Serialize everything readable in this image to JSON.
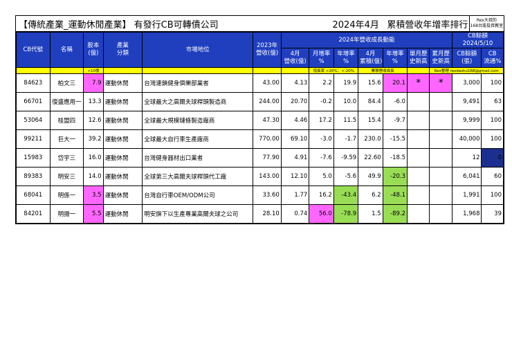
{
  "title": {
    "main": "【傳統產業_運動休閒產業】 有發行CB可轉債公司",
    "month": "2024年4月",
    "rank": "累積營收年增率排行"
  },
  "badge": {
    "line1": "Rex大叔的",
    "line2": "168台股投資教室"
  },
  "headers": {
    "cb_code": "CB代號",
    "name": "名稱",
    "capital": "股本\n(億)",
    "category": "產業\n分類",
    "position": "市場地位",
    "rev2023": "2023年\n營收(億)",
    "group_growth": "2024年營收成長動能",
    "apr_rev": "4月\n營收(億)",
    "mom": "月增率\n%",
    "yoy": "年增率\n%",
    "apr_cum": "4月\n累積(億)",
    "cum_yoy": "年增率\n%",
    "single_high": "單月歷\n史新高",
    "cum_high": "累月歷\n史新高",
    "group_cb": "CB餘額\n2024/5/10",
    "cb_bal": "CB餘額\n(張)",
    "cb_ratio": "CB\n流通%"
  },
  "notes": {
    "capital": "<10億",
    "mom": "增長率 >20%；<-20%",
    "cum": "累積營收成長",
    "rex": "Rex整理 rexdashu168@gmail.com"
  },
  "rows": [
    {
      "code": "84623",
      "name": "柏文三",
      "capital": "7.9",
      "category": "運動休閒",
      "position": "台灣連鎖健身俱樂部業者",
      "rev2023": "43.00",
      "apr_rev": "4.13",
      "mom": "2.2",
      "yoy": "19.9",
      "apr_cum": "15.6",
      "cum_yoy": "20.1",
      "single_high": "*",
      "cum_high": "*",
      "cb_bal": "3,000",
      "cb_ratio": "100"
    },
    {
      "code": "66701",
      "name": "復盛應用一",
      "capital": "13.3",
      "category": "運動休閒",
      "position": "全球最大之高爾夫球桿頭製造商",
      "rev2023": "244.00",
      "apr_rev": "20.70",
      "mom": "-0.2",
      "yoy": "10.0",
      "apr_cum": "84.4",
      "cum_yoy": "-6.0",
      "single_high": "",
      "cum_high": "",
      "cb_bal": "9,491",
      "cb_ratio": "63"
    },
    {
      "code": "53064",
      "name": "桂盟四",
      "capital": "12.6",
      "category": "運動休閒",
      "position": "全球最大規模鏈條製造廠商",
      "rev2023": "47.30",
      "apr_rev": "4.46",
      "mom": "17.2",
      "yoy": "11.5",
      "apr_cum": "15.4",
      "cum_yoy": "-9.7",
      "single_high": "",
      "cum_high": "",
      "cb_bal": "9,999",
      "cb_ratio": "100"
    },
    {
      "code": "99211",
      "name": "巨大一",
      "capital": "39.2",
      "category": "運動休閒",
      "position": "全球最大自行車生產廠商",
      "rev2023": "770.00",
      "apr_rev": "69.10",
      "mom": "-3.0",
      "yoy": "-1.7",
      "apr_cum": "230.0",
      "cum_yoy": "-15.5",
      "single_high": "",
      "cum_high": "",
      "cb_bal": "40,000",
      "cb_ratio": "100"
    },
    {
      "code": "15983",
      "name": "岱宇三",
      "capital": "16.0",
      "category": "運動休閒",
      "position": "台灣健身器材出口業者",
      "rev2023": "77.90",
      "apr_rev": "4.91",
      "mom": "-7.6",
      "yoy": "-9.59",
      "apr_cum": "22.60",
      "cum_yoy": "-18.5",
      "single_high": "",
      "cum_high": "",
      "cb_bal": "12",
      "cb_ratio": "0"
    },
    {
      "code": "89383",
      "name": "明安三",
      "capital": "14.0",
      "category": "運動休閒",
      "position": "全球第三大高爾夫球桿頭代工廠",
      "rev2023": "143.00",
      "apr_rev": "12.10",
      "mom": "5.0",
      "yoy": "-5.6",
      "apr_cum": "49.9",
      "cum_yoy": "-20.3",
      "single_high": "",
      "cum_high": "",
      "cb_bal": "6,041",
      "cb_ratio": "60"
    },
    {
      "code": "68041",
      "name": "明係一",
      "capital": "3.5",
      "category": "運動休閒",
      "position": "台灣自行車OEM/ODM公司",
      "rev2023": "33.60",
      "apr_rev": "1.77",
      "mom": "16.2",
      "yoy": "-43.4",
      "apr_cum": "6.2",
      "cum_yoy": "-48.1",
      "single_high": "",
      "cum_high": "",
      "cb_bal": "1,991",
      "cb_ratio": "100"
    },
    {
      "code": "84201",
      "name": "明揚一",
      "capital": "5.5",
      "category": "運動休閒",
      "position": "明安旗下以生產專業高爾夫球之公司",
      "rev2023": "28.10",
      "apr_rev": "0.74",
      "mom": "56.0",
      "yoy": "-78.9",
      "apr_cum": "1.5",
      "cum_yoy": "-89.2",
      "single_high": "",
      "cum_high": "",
      "cb_bal": "1,968",
      "cb_ratio": "39"
    }
  ],
  "highlights": {
    "pink": "#ff66ff",
    "green": "#99dd55",
    "navy": "#1a2f8f",
    "header_blue": "#1f3fbf",
    "note_yellow": "#ffff00"
  }
}
